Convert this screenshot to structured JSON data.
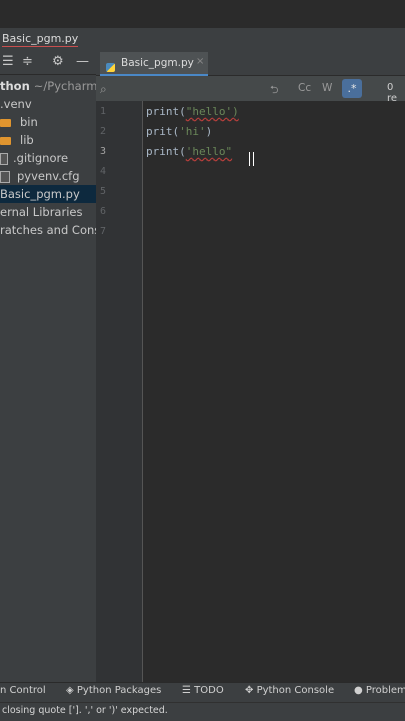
{
  "breadcrumb": {
    "file": "Basic_pgm.py"
  },
  "project_tree": {
    "root_label": "thon",
    "root_path": "~/PycharmP",
    "items": [
      {
        "label": ".venv",
        "kind": "folder"
      },
      {
        "label": "bin",
        "kind": "folder"
      },
      {
        "label": "lib",
        "kind": "folder"
      },
      {
        "label": ".gitignore",
        "kind": "file"
      },
      {
        "label": "pyvenv.cfg",
        "kind": "file"
      },
      {
        "label": "Basic_pgm.py",
        "kind": "python",
        "selected": true
      },
      {
        "label": "ernal Libraries",
        "kind": "group"
      },
      {
        "label": "ratches and Conso",
        "kind": "group"
      }
    ]
  },
  "tabs": [
    {
      "label": "Basic_pgm.py",
      "active": true
    }
  ],
  "search": {
    "results": "0 re",
    "case_label": "Cc",
    "word_label": "W",
    "regex_label": ".*"
  },
  "editor": {
    "line_numbers": [
      "1",
      "2",
      "3",
      "4",
      "5",
      "6",
      "7"
    ],
    "lines": [
      {
        "func": "print",
        "open": "(",
        "string": "\"hello')",
        "close": ""
      },
      {
        "func": "prit",
        "open": "(",
        "string": "'hi'",
        "close": ")"
      },
      {
        "func": "print",
        "open": "(",
        "string": "'hello\"",
        "close": ""
      }
    ]
  },
  "tool_windows": [
    "n Control",
    "Python Packages",
    "TODO",
    "Python Console",
    "Problem"
  ],
  "status": {
    "message": "closing quote [']. ',' or ')' expected."
  },
  "colors": {
    "accent": "#4a88c7",
    "string": "#6a8759",
    "error": "#bc3f3c"
  }
}
